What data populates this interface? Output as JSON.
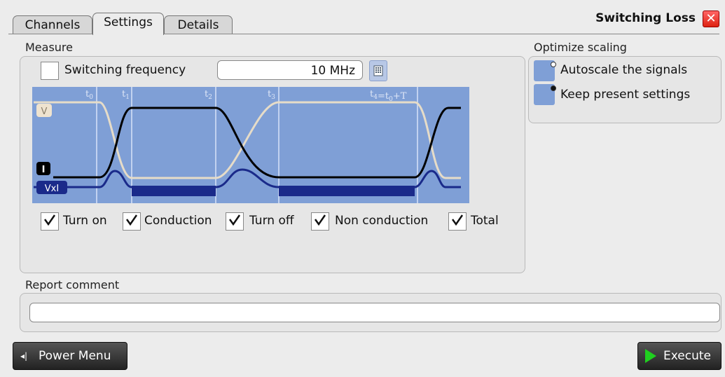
{
  "tabs": [
    {
      "label": "Channels"
    },
    {
      "label": "Settings"
    },
    {
      "label": "Details"
    }
  ],
  "window_title": "Switching Loss",
  "measure": {
    "label": "Measure",
    "switching_frequency_label": "Switching frequency",
    "switching_frequency_checked": false,
    "frequency_value": "10 MHz",
    "diagram": {
      "time_markers": [
        "t0",
        "t1",
        "t2",
        "t3",
        "t4=t0+T"
      ],
      "signal_labels": {
        "v": "V",
        "i": "I",
        "vxi": "VxI"
      }
    },
    "options": [
      {
        "label": "Turn on",
        "checked": true
      },
      {
        "label": "Conduction",
        "checked": true
      },
      {
        "label": "Turn off",
        "checked": true
      },
      {
        "label": "Non conduction",
        "checked": true
      },
      {
        "label": "Total",
        "checked": true
      }
    ]
  },
  "optimize_scaling": {
    "label": "Optimize scaling",
    "options": [
      {
        "label": "Autoscale the signals",
        "selected": false
      },
      {
        "label": "Keep present settings",
        "selected": true
      }
    ]
  },
  "report": {
    "label": "Report comment",
    "value": ""
  },
  "buttons": {
    "power_menu": "Power Menu",
    "execute": "Execute"
  },
  "colors": {
    "diagram_bg": "#7f9fd6",
    "accent_blue": "#1a2a8a",
    "execute_green": "#1fd01f"
  }
}
